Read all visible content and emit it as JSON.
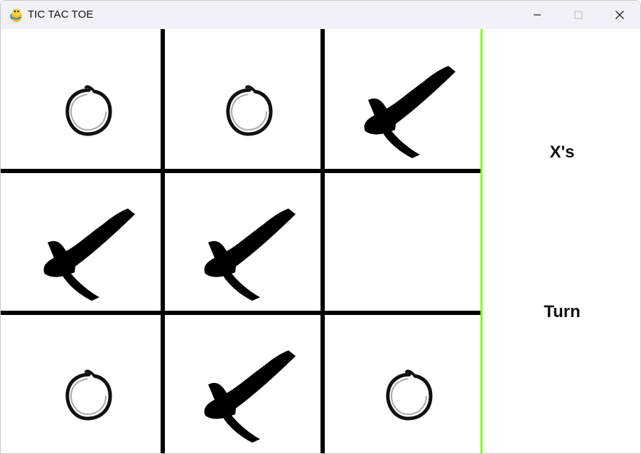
{
  "window": {
    "title": "TIC TAC TOE",
    "icon": "pygame-snake-icon",
    "controls": [
      "minimize-icon",
      "maximize-icon",
      "close-icon"
    ]
  },
  "board": {
    "cells": [
      [
        "O",
        "O",
        "X"
      ],
      [
        "X",
        "X",
        ""
      ],
      [
        "O",
        "X",
        "O"
      ]
    ]
  },
  "status": {
    "player": "X's",
    "turn": "Turn"
  },
  "colors": {
    "grid": "#000000",
    "divider": "#7fff1c",
    "mark": "#000000",
    "titlebar": "#eff3f9"
  }
}
